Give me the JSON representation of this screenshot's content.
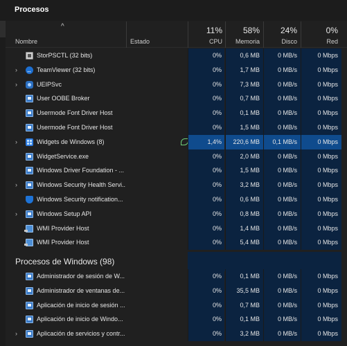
{
  "window": {
    "title": "Procesos"
  },
  "header": {
    "sort_arrow": "^",
    "name_label": "Nombre",
    "state_label": "Estado",
    "cpu": {
      "pct": "11%",
      "label": "CPU"
    },
    "memory": {
      "pct": "58%",
      "label": "Memoria"
    },
    "disk": {
      "pct": "24%",
      "label": "Disco"
    },
    "network": {
      "pct": "0%",
      "label": "Red"
    }
  },
  "apps": [
    {
      "name": "StorPSCTL (32 bits)",
      "icon": "storpsctl-icon",
      "expand": false,
      "state": "",
      "cpu": "0%",
      "mem": "0,6 MB",
      "disk": "0 MB/s",
      "net": "0 Mbps"
    },
    {
      "name": "TeamViewer (32 bits)",
      "icon": "teamviewer-icon",
      "expand": true,
      "state": "",
      "cpu": "0%",
      "mem": "1,7 MB",
      "disk": "0 MB/s",
      "net": "0 Mbps"
    },
    {
      "name": "UEIPSvc",
      "icon": "ueipsvc-icon",
      "expand": true,
      "state": "",
      "cpu": "0%",
      "mem": "7,3 MB",
      "disk": "0 MB/s",
      "net": "0 Mbps"
    },
    {
      "name": "User OOBE Broker",
      "icon": "process-icon",
      "expand": false,
      "state": "",
      "cpu": "0%",
      "mem": "0,7 MB",
      "disk": "0 MB/s",
      "net": "0 Mbps"
    },
    {
      "name": "Usermode Font Driver Host",
      "icon": "process-icon",
      "expand": false,
      "state": "",
      "cpu": "0%",
      "mem": "0,1 MB",
      "disk": "0 MB/s",
      "net": "0 Mbps"
    },
    {
      "name": "Usermode Font Driver Host",
      "icon": "process-icon",
      "expand": false,
      "state": "",
      "cpu": "0%",
      "mem": "1,5 MB",
      "disk": "0 MB/s",
      "net": "0 Mbps"
    },
    {
      "name": "Widgets de Windows (8)",
      "icon": "widgets-icon",
      "expand": true,
      "state": "eco-leaf-icon",
      "cpu": "1,4%",
      "mem": "220,6 MB",
      "disk": "0,1 MB/s",
      "net": "0 Mbps",
      "highlight": true
    },
    {
      "name": "WidgetService.exe",
      "icon": "process-icon",
      "expand": false,
      "state": "",
      "cpu": "0%",
      "mem": "2,0 MB",
      "disk": "0 MB/s",
      "net": "0 Mbps"
    },
    {
      "name": "Windows Driver Foundation - ...",
      "icon": "process-icon",
      "expand": false,
      "state": "",
      "cpu": "0%",
      "mem": "1,5 MB",
      "disk": "0 MB/s",
      "net": "0 Mbps"
    },
    {
      "name": "Windows Security Health Servi...",
      "icon": "process-icon",
      "expand": true,
      "state": "",
      "cpu": "0%",
      "mem": "3,2 MB",
      "disk": "0 MB/s",
      "net": "0 Mbps"
    },
    {
      "name": "Windows Security notification...",
      "icon": "shield-icon",
      "expand": false,
      "state": "",
      "cpu": "0%",
      "mem": "0,6 MB",
      "disk": "0 MB/s",
      "net": "0 Mbps"
    },
    {
      "name": "Windows Setup API",
      "icon": "process-icon",
      "expand": true,
      "state": "",
      "cpu": "0%",
      "mem": "0,8 MB",
      "disk": "0 MB/s",
      "net": "0 Mbps"
    },
    {
      "name": "WMI Provider Host",
      "icon": "wmi-icon",
      "expand": false,
      "state": "",
      "cpu": "0%",
      "mem": "1,4 MB",
      "disk": "0 MB/s",
      "net": "0 Mbps"
    },
    {
      "name": "WMI Provider Host",
      "icon": "wmi-icon",
      "expand": false,
      "state": "",
      "cpu": "0%",
      "mem": "5,4 MB",
      "disk": "0 MB/s",
      "net": "0 Mbps"
    }
  ],
  "windows_group": {
    "title": "Procesos de Windows (98)",
    "rows": [
      {
        "name": "Administrador de sesión de W...",
        "icon": "process-icon",
        "expand": false,
        "state": "",
        "cpu": "0%",
        "mem": "0,1 MB",
        "disk": "0 MB/s",
        "net": "0 Mbps"
      },
      {
        "name": "Administrador de ventanas de...",
        "icon": "process-icon",
        "expand": false,
        "state": "",
        "cpu": "0%",
        "mem": "35,5 MB",
        "disk": "0 MB/s",
        "net": "0 Mbps"
      },
      {
        "name": "Aplicación de inicio de sesión ...",
        "icon": "process-icon",
        "expand": false,
        "state": "",
        "cpu": "0%",
        "mem": "0,7 MB",
        "disk": "0 MB/s",
        "net": "0 Mbps"
      },
      {
        "name": "Aplicación de inicio de Windo...",
        "icon": "process-icon",
        "expand": false,
        "state": "",
        "cpu": "0%",
        "mem": "0,1 MB",
        "disk": "0 MB/s",
        "net": "0 Mbps"
      },
      {
        "name": "Aplicación de servicios y contr...",
        "icon": "process-icon",
        "expand": true,
        "state": "",
        "cpu": "0%",
        "mem": "3,2 MB",
        "disk": "0 MB/s",
        "net": "0 Mbps"
      }
    ]
  },
  "colors": {
    "background": "#202020",
    "column_tint": "#0b2340",
    "highlight": "#0f4b8d",
    "eco_leaf": "#6fcf7a"
  }
}
